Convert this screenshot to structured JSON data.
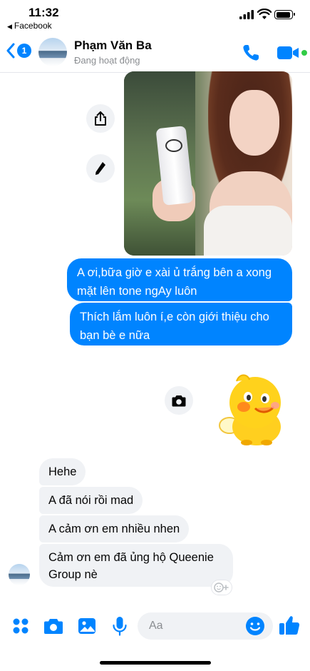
{
  "status_bar": {
    "time": "11:32",
    "back_app": "Facebook",
    "battery_level": 0.8
  },
  "header": {
    "unread_count": "1",
    "contact_name": "Phạm Văn Ba",
    "presence": "Đang hoạt động"
  },
  "messages": {
    "outgoing": [
      "A ơi,bữa giờ e xài ủ trắng bên a xong mặt lên tone ngAy luôn",
      "Thích lắm luôn í,e còn giới thiệu cho bạn bè e nữa"
    ],
    "incoming": [
      "Hehe",
      "A đã nói rồi mad",
      "A cảm ơn em nhiều nhen",
      "Cảm ơn em đã ủng hộ Queenie Group nè"
    ]
  },
  "composer": {
    "placeholder": "Aa"
  },
  "icons": {
    "share": "share-icon",
    "edit": "pencil-icon",
    "camera": "camera-icon",
    "apps": "four-dots-icon",
    "gallery": "image-icon",
    "mic": "microphone-icon",
    "emoji": "smiley-icon",
    "like": "thumbs-up-icon",
    "call": "phone-icon",
    "video": "video-camera-icon"
  },
  "colors": {
    "accent": "#0084ff",
    "incoming_bubble": "#f0f2f5",
    "online": "#31cc46"
  }
}
